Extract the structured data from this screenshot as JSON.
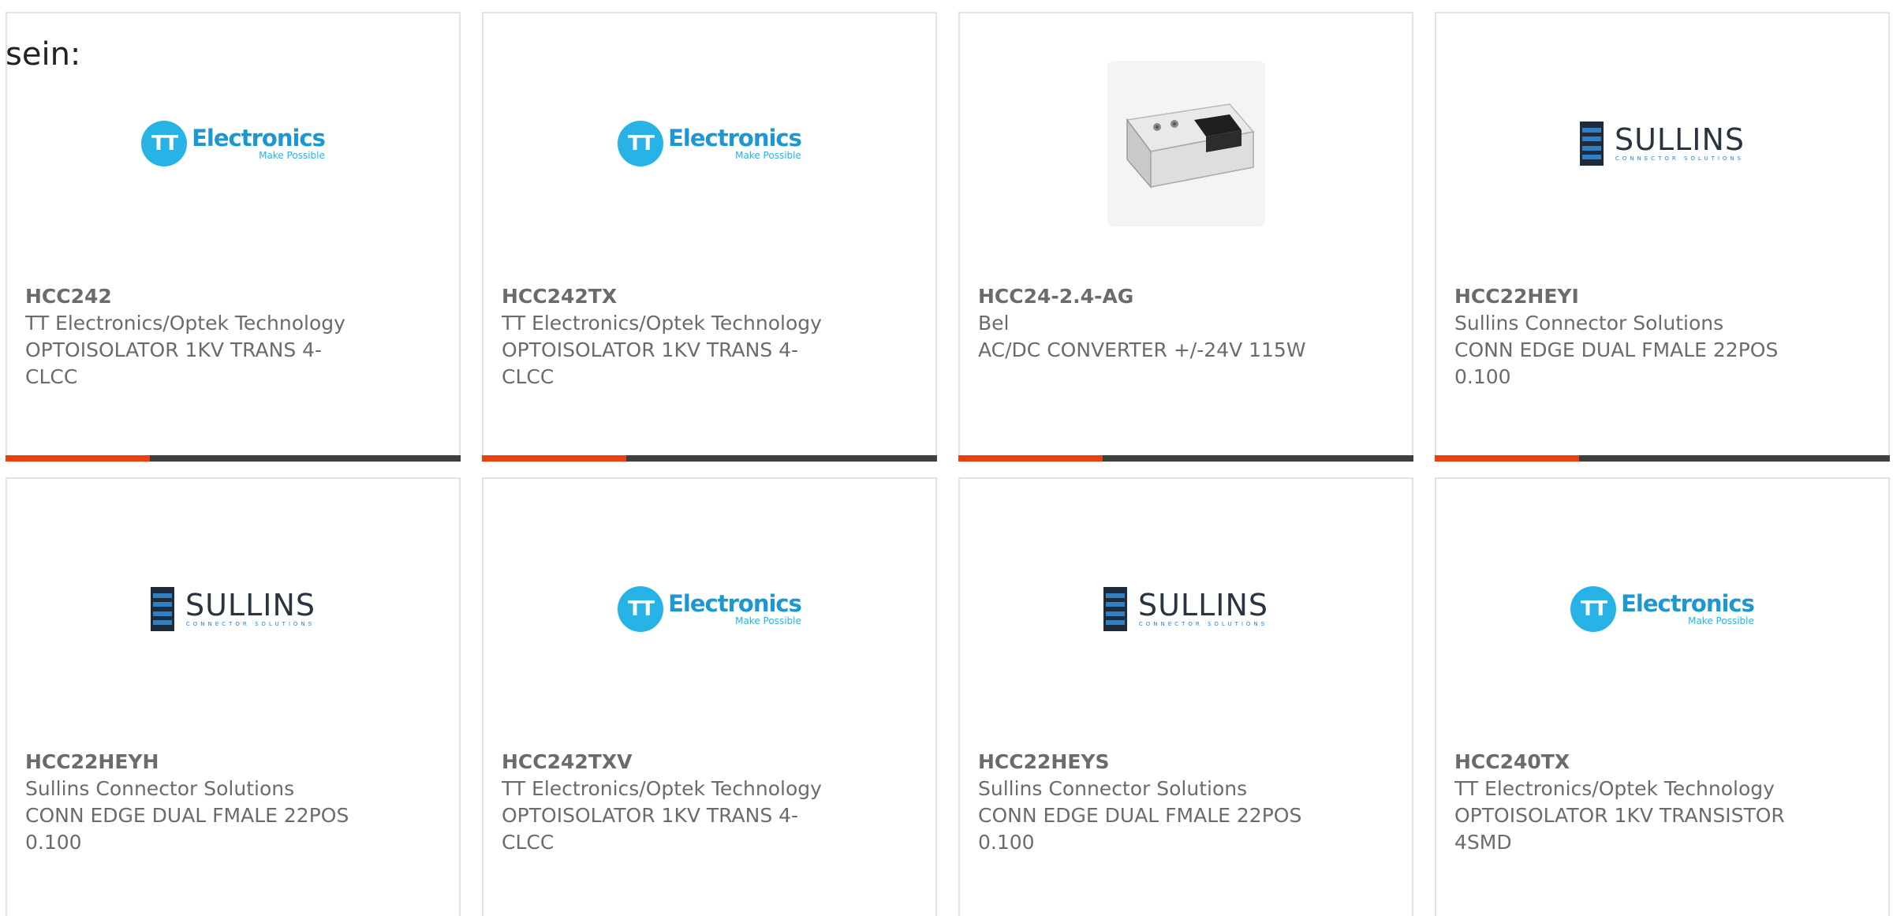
{
  "prefix_text": "sein:",
  "logos": {
    "tt": {
      "initials": "TT",
      "word": "Electronics",
      "tagline": "Make Possible"
    },
    "sullins": {
      "word": "SULLINS",
      "tagline": "CONNECTOR SOLUTIONS"
    }
  },
  "colors": {
    "accent": "#e8410f",
    "bar": "#3f3f3f",
    "text": "#6b6b6b",
    "tt_blue": "#27b3e6",
    "sullins_navy": "#1d2b3a"
  },
  "cards": [
    {
      "part": "HCC242",
      "manufacturer": "TT Electronics/Optek Technology",
      "description": "OPTOISOLATOR 1KV TRANS 4-CLCC",
      "logo": "tt"
    },
    {
      "part": "HCC242TX",
      "manufacturer": "TT Electronics/Optek Technology",
      "description": "OPTOISOLATOR 1KV TRANS 4-CLCC",
      "logo": "tt"
    },
    {
      "part": "HCC24-2.4-AG",
      "manufacturer": "Bel",
      "description": "AC/DC CONVERTER +/-24V 115W",
      "logo": "product-photo"
    },
    {
      "part": "HCC22HEYI",
      "manufacturer": "Sullins Connector Solutions",
      "description": "CONN EDGE DUAL FMALE 22POS 0.100",
      "logo": "sullins"
    },
    {
      "part": "HCC22HEYH",
      "manufacturer": "Sullins Connector Solutions",
      "description": "CONN EDGE DUAL FMALE 22POS 0.100",
      "logo": "sullins"
    },
    {
      "part": "HCC242TXV",
      "manufacturer": "TT Electronics/Optek Technology",
      "description": "OPTOISOLATOR 1KV TRANS 4-CLCC",
      "logo": "tt"
    },
    {
      "part": "HCC22HEYS",
      "manufacturer": "Sullins Connector Solutions",
      "description": "CONN EDGE DUAL FMALE 22POS 0.100",
      "logo": "sullins"
    },
    {
      "part": "HCC240TX",
      "manufacturer": "TT Electronics/Optek Technology",
      "description": "OPTOISOLATOR 1KV TRANSISTOR 4SMD",
      "logo": "tt"
    }
  ]
}
